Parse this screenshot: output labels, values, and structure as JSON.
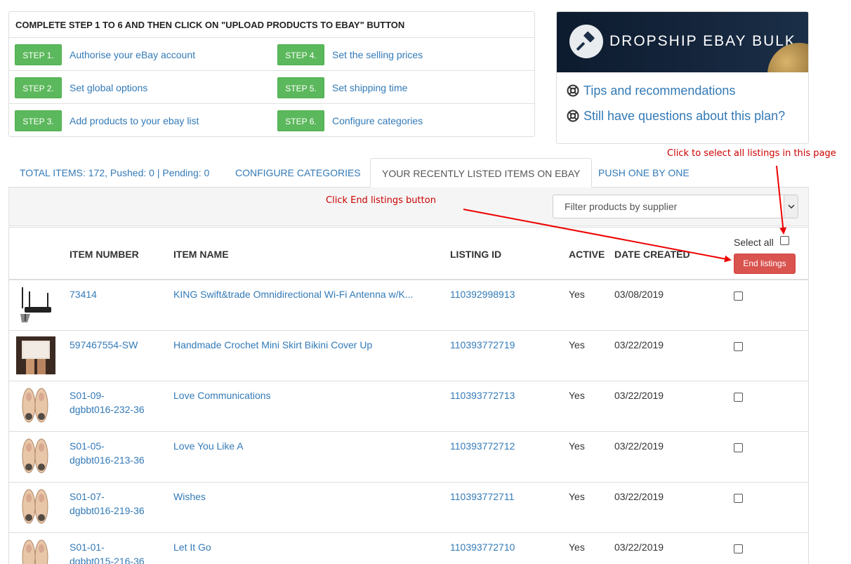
{
  "steps_panel": {
    "title": "COMPLETE STEP 1 TO 6 AND THEN CLICK ON \"UPLOAD PRODUCTS TO EBAY\" BUTTON",
    "steps": [
      {
        "badge": "STEP 1.",
        "label": "Authorise your eBay account"
      },
      {
        "badge": "STEP 2.",
        "label": "Set global options"
      },
      {
        "badge": "STEP 3.",
        "label": "Add products to your ebay list"
      },
      {
        "badge": "STEP 4.",
        "label": "Set the selling prices"
      },
      {
        "badge": "STEP 5.",
        "label": "Set shipping time"
      },
      {
        "badge": "STEP 6.",
        "label": "Configure categories"
      }
    ]
  },
  "promo": {
    "title": "DROPSHIP EBAY BULK",
    "links": [
      "Tips and recommendations",
      "Still have questions about this plan?"
    ]
  },
  "annotations": {
    "select_all_hint": "Click to select all listings in this page",
    "end_listings_hint": "Click End listings button"
  },
  "tabs": [
    {
      "label": "TOTAL ITEMS: 172, Pushed: 0 | Pending: 0",
      "active": false
    },
    {
      "label": "CONFIGURE CATEGORIES",
      "active": false
    },
    {
      "label": "YOUR RECENTLY LISTED ITEMS ON EBAY",
      "active": true
    },
    {
      "label": "PUSH ONE BY ONE",
      "active": false
    }
  ],
  "filter": {
    "placeholder": "Filter products by supplier"
  },
  "table": {
    "headers": {
      "item_number": "ITEM NUMBER",
      "item_name": "ITEM NAME",
      "listing_id": "LISTING ID",
      "active": "ACTIVE",
      "date_created": "DATE CREATED"
    },
    "select_all_label": "Select all",
    "end_button": "End listings",
    "rows": [
      {
        "item_number": "73414",
        "item_name": "KING Swift&trade Omnidirectional Wi-Fi Antenna w/K...",
        "listing_id": "110392998913",
        "active": "Yes",
        "date": "03/08/2019",
        "thumb": "antenna"
      },
      {
        "item_number": "597467554-SW",
        "item_name": "Handmade Crochet Mini Skirt Bikini Cover Up",
        "listing_id": "110393772719",
        "active": "Yes",
        "date": "03/22/2019",
        "thumb": "skirt"
      },
      {
        "item_number": "S01-09-\ndgbbt016-232-36",
        "item_name": "Love Communications",
        "listing_id": "110393772713",
        "active": "Yes",
        "date": "03/22/2019",
        "thumb": "shoes"
      },
      {
        "item_number": "S01-05-\ndgbbt016-213-36",
        "item_name": "Love You Like A",
        "listing_id": "110393772712",
        "active": "Yes",
        "date": "03/22/2019",
        "thumb": "shoes"
      },
      {
        "item_number": "S01-07-\ndgbbt016-219-36",
        "item_name": "Wishes",
        "listing_id": "110393772711",
        "active": "Yes",
        "date": "03/22/2019",
        "thumb": "shoes"
      },
      {
        "item_number": "S01-01-\ndgbbt015-216-36",
        "item_name": "Let It Go",
        "listing_id": "110393772710",
        "active": "Yes",
        "date": "03/22/2019",
        "thumb": "shoes"
      }
    ]
  }
}
